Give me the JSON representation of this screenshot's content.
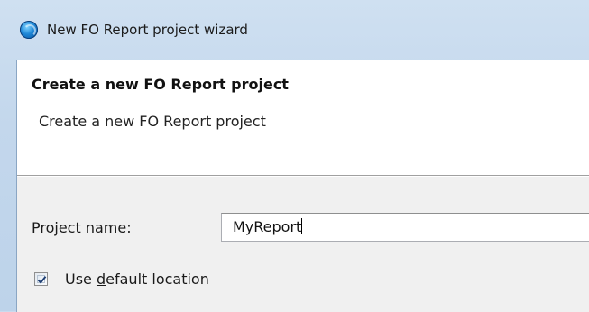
{
  "window": {
    "title": "New FO Report project wizard",
    "icon": "eclipse-app-icon"
  },
  "banner": {
    "title": "Create a new FO Report project",
    "description": "Create a new FO Report project"
  },
  "form": {
    "project_name": {
      "label_mnemonic": "P",
      "label_rest": "roject name:",
      "value": "MyReport"
    },
    "use_default_location": {
      "label_prefix": "Use ",
      "label_mnemonic": "d",
      "label_rest": "efault location",
      "checked": true
    }
  },
  "colors": {
    "check_mark": "#1f3f73",
    "title_bar": "#c9dbee"
  }
}
